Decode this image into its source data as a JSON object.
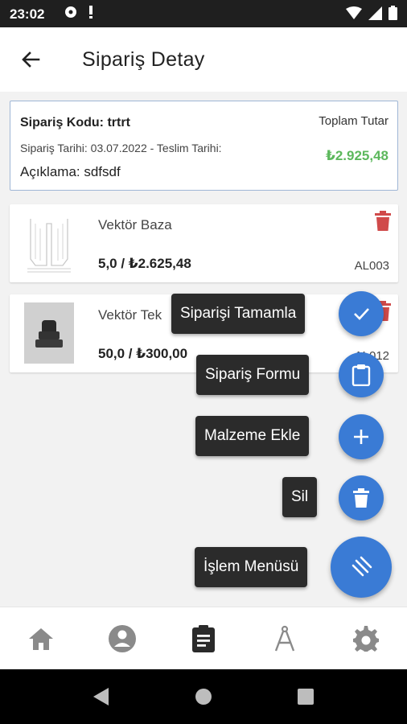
{
  "status_bar": {
    "time": "23:02"
  },
  "header": {
    "title": "Sipariş Detay"
  },
  "order": {
    "code_label": "Sipariş Kodu: trtrt",
    "total_label": "Toplam Tutar",
    "dates": "Sipariş Tarihi: 03.07.2022 - Teslim Tarihi:",
    "total_value": "₺2.925,48",
    "description": "Açıklama: sdfsdf"
  },
  "items": [
    {
      "name": "Vektör Baza",
      "price": "5,0 / ₺2.625,48",
      "code": "AL003"
    },
    {
      "name": "Vektör Tek",
      "price": "50,0 / ₺300,00",
      "code": "AL012"
    }
  ],
  "fab_menu": {
    "complete": "Siparişi Tamamla",
    "form": "Sipariş Formu",
    "add_material": "Malzeme Ekle",
    "delete": "Sil",
    "main": "İşlem Menüsü"
  },
  "bottom_nav": [
    "home-icon",
    "account-icon",
    "clipboard-icon",
    "compass-icon",
    "settings-icon"
  ],
  "colors": {
    "accent": "#3a7bd5",
    "total": "#5cb85c",
    "trash": "#d04a4a"
  }
}
